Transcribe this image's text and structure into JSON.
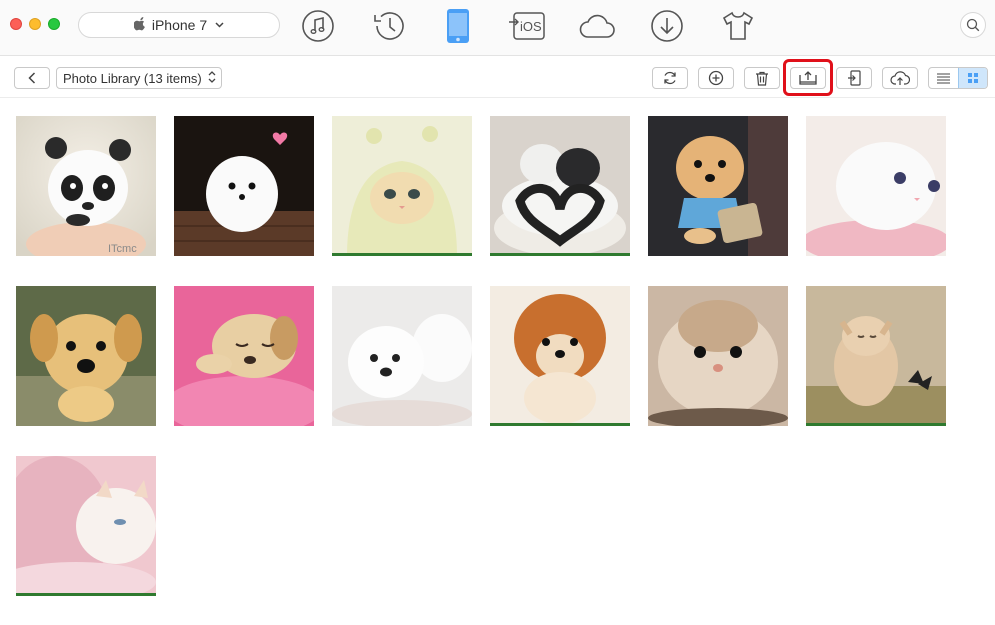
{
  "window": {
    "device_name": "iPhone 7",
    "device_icon": "apple-logo-icon",
    "nav_icons": [
      "music-icon",
      "history-icon",
      "iphone-icon",
      "to-ios-icon",
      "cloud-icon",
      "download-icon",
      "tshirt-icon"
    ],
    "to_ios_label": "iOS",
    "active_nav": "iphone-icon",
    "accent_color": "#4a9ff5"
  },
  "toolbar": {
    "library_label": "Photo Library (13 items)",
    "buttons": [
      "back-icon",
      "refresh-icon",
      "add-icon",
      "delete-icon",
      "export-to-computer-icon",
      "send-to-device-icon",
      "upload-cloud-icon"
    ],
    "highlighted_button": "export-to-computer-icon",
    "highlight_color": "#e0101a",
    "view_modes": [
      "list-view-icon",
      "grid-view-icon"
    ],
    "active_view": "grid-view-icon"
  },
  "photos": [
    {
      "subject": "panda puppy in hand",
      "watermark": "ITcmc"
    },
    {
      "subject": "white pomeranian puppy with heart"
    },
    {
      "subject": "kitten in hooded costume"
    },
    {
      "subject": "white and black cats with tails forming heart"
    },
    {
      "subject": "pomeranian holding sign"
    },
    {
      "subject": "white kitten on pink blanket"
    },
    {
      "subject": "golden retriever puppy"
    },
    {
      "subject": "sleeping puppy on pink fur"
    },
    {
      "subject": "two white puppies"
    },
    {
      "subject": "orange pomeranian boo"
    },
    {
      "subject": "hamster close-up"
    },
    {
      "subject": "kitten with butterfly"
    },
    {
      "subject": "kitten sleeping on pink"
    }
  ]
}
